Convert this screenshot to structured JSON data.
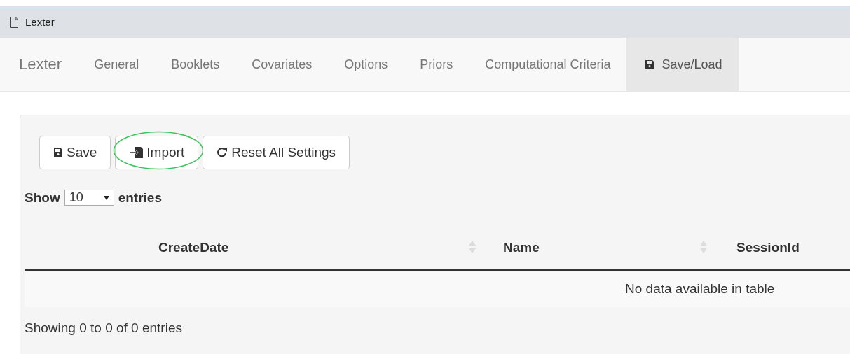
{
  "window": {
    "title": "Lexter"
  },
  "navbar": {
    "brand": "Lexter",
    "items": [
      {
        "label": "General",
        "selected": false
      },
      {
        "label": "Booklets",
        "selected": false
      },
      {
        "label": "Covariates",
        "selected": false
      },
      {
        "label": "Options",
        "selected": false
      },
      {
        "label": "Priors",
        "selected": false
      },
      {
        "label": "Computational Criteria",
        "selected": false
      },
      {
        "label": "Save/Load",
        "selected": true,
        "kind": "save"
      }
    ]
  },
  "toolbar": [
    {
      "label": "Save",
      "kind": "save",
      "highlighted": false
    },
    {
      "label": "Import",
      "kind": "import",
      "highlighted": true
    },
    {
      "label": "Reset All Settings",
      "kind": "reset",
      "highlighted": false
    }
  ],
  "length": {
    "prefix": "Show",
    "value": "10",
    "suffix": "entries"
  },
  "table": {
    "columns": [
      "CreateDate",
      "Name",
      "SessionId"
    ],
    "empty_message": "No data available in table"
  },
  "info": "Showing 0 to 0 of 0 entries"
}
